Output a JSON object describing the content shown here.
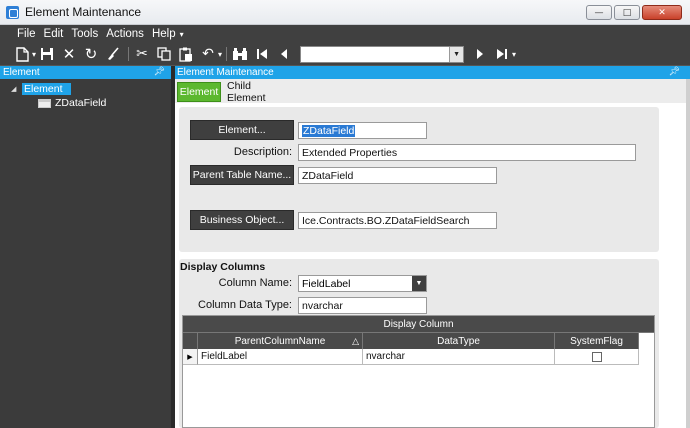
{
  "window": {
    "title": "Element Maintenance",
    "controls": {
      "minimize": "—",
      "maximize": "□",
      "close": "✕"
    }
  },
  "menu": [
    "File",
    "Edit",
    "Tools",
    "Actions",
    "Help"
  ],
  "toolbar": {
    "icons": [
      "new-icon",
      "save-icon",
      "delete-icon",
      "refresh-icon",
      "clear-icon",
      "cut-icon",
      "copy-icon",
      "paste-icon",
      "undo-icon",
      "search-icon",
      "first-record-icon",
      "previous-record-icon",
      "next-record-icon",
      "last-record-icon"
    ],
    "navigation_value": ""
  },
  "tree_panel": {
    "header": "Element",
    "root": "Element",
    "child": "ZDataField"
  },
  "main_panel": {
    "header": "Element Maintenance",
    "tabs": [
      {
        "label": "Element",
        "active": true
      },
      {
        "label": "Child Element",
        "active": false
      }
    ]
  },
  "form": {
    "element_button": "Element...",
    "element_value": "ZDataField",
    "description_label": "Description:",
    "description_value": "Extended Properties",
    "parent_table_button": "Parent Table Name...",
    "parent_table_value": "ZDataField",
    "business_object_button": "Business Object...",
    "business_object_value": "Ice.Contracts.BO.ZDataFieldSearch"
  },
  "display_columns": {
    "title": "Display Columns",
    "column_name_label": "Column Name:",
    "column_name_value": "FieldLabel",
    "column_data_type_label": "Column Data Type:",
    "column_data_type_value": "nvarchar",
    "grid": {
      "band_title": "Display Column",
      "columns": [
        "ParentColumnName",
        "DataType",
        "SystemFlag"
      ],
      "sort_indicator": "△",
      "rows": [
        {
          "ParentColumnName": "FieldLabel",
          "DataType": "nvarchar",
          "SystemFlag": false
        }
      ]
    }
  },
  "colors": {
    "accent_blue": "#1fa3e8",
    "tab_green": "#5cb82f",
    "dark_chrome": "#404040"
  }
}
